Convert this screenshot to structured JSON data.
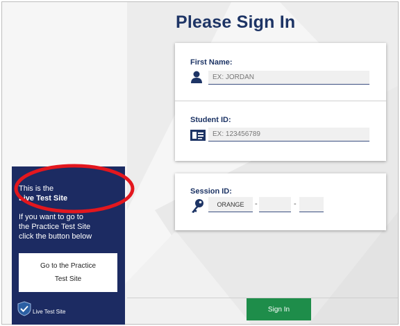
{
  "header": {
    "title": "Please Sign In"
  },
  "form": {
    "first_name": {
      "label": "First Name:",
      "placeholder": "EX: JORDAN",
      "icon": "person-icon"
    },
    "student_id": {
      "label": "Student ID:",
      "placeholder": "EX: 123456789",
      "icon": "id-card-icon"
    },
    "session_id": {
      "label": "Session ID:",
      "icon": "key-icon",
      "prefix": "ORANGE",
      "separator": "-",
      "part2": "",
      "part3": ""
    }
  },
  "info_panel": {
    "line1": "This is the",
    "line2": "Live Test Site",
    "line3": "If you want to go to",
    "line4": "the Practice Test Site",
    "line5": "click the button below",
    "practice_button": {
      "line1": "Go to the Practice",
      "line2": "Test Site"
    },
    "footer_label": "Live Test Site",
    "footer_icon": "shield-check-icon"
  },
  "actions": {
    "sign_in": "Sign In"
  },
  "colors": {
    "title": "#1d3465",
    "panel": "#1c2b62",
    "sign_in": "#1e8d4a",
    "annotation": "#e3171e"
  }
}
